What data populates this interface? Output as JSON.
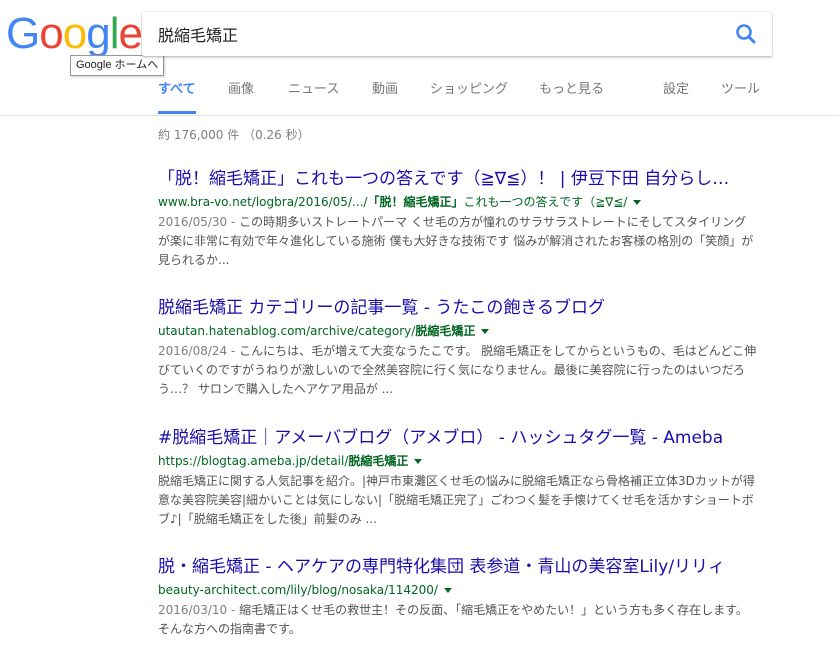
{
  "logo": {
    "letters": [
      "G",
      "o",
      "o",
      "g",
      "l",
      "e"
    ],
    "colors": [
      "#4285f4",
      "#ea4335",
      "#fbbc05",
      "#4285f4",
      "#34a853",
      "#ea4335"
    ]
  },
  "tooltip": "Google ホームへ",
  "search": {
    "query": "脱縮毛矯正",
    "icon": "search-icon",
    "accent": "#4285f4"
  },
  "tabs": [
    "すべて",
    "画像",
    "ニュース",
    "動画",
    "ショッピング",
    "もっと見る",
    "設定",
    "ツール"
  ],
  "stats": "約 176,000 件 （0.26 秒）",
  "results": [
    {
      "title": "「脱！縮毛矯正」これも一つの答えです（≧∇≦）！ | 伊豆下田 自分らし…",
      "url_pre": "www.bra-vo.net/logbra/2016/05/.../",
      "url_bold": "「脱！縮毛矯正」",
      "url_post": "これも一つの答えです（≧∇≦/",
      "date": "2016/05/30 - ",
      "snippet": "この時期多いストレートパーマ くせ毛の方が憧れのサラサラストレートにそしてスタイリングが楽に非常に有効で年々進化している施術 僕も大好きな技術です 悩みが解消されたお客様の格別の「笑顔」が見られるか..."
    },
    {
      "title": "脱縮毛矯正 カテゴリーの記事一覧 - うたこの飽きるブログ",
      "url_pre": "utautan.hatenablog.com/archive/category/",
      "url_bold": "脱縮毛矯正",
      "url_post": "",
      "date": "2016/08/24 - ",
      "snippet": "こんにちは、毛が増えて大変なうたこです。 脱縮毛矯正をしてからというもの、毛はどんどこ伸びていくのですがうねりが激しいので全然美容院に行く気になりません。最後に美容院に行ったのはいつだろう…？ サロンで購入したヘアケア用品が ..."
    },
    {
      "title": "#脱縮毛矯正｜アメーバブログ（アメブロ） - ハッシュタグ一覧 - Ameba",
      "url_pre": "https://blogtag.ameba.jp/detail/",
      "url_bold": "脱縮毛矯正",
      "url_post": "",
      "date": "",
      "snippet": "脱縮毛矯正に関する人気記事を紹介。|神戸市東灘区くせ毛の悩みに脱縮毛矯正なら骨格補正立体3Dカットが得意な美容院美容|細かいことは気にしない|「脱縮毛矯正完了」ごわつく髪を手懐けてくせ毛を活かすショートボブ♪|「脱縮毛矯正をした後」前髪のみ ..."
    },
    {
      "title": "脱・縮毛矯正 - ヘアケアの専門特化集団 表参道・青山の美容室Lily/リリィ",
      "url_pre": "beauty-architect.com/lily/blog/nosaka/114200/",
      "url_bold": "",
      "url_post": "",
      "date": "2016/03/10 - ",
      "snippet": "縮毛矯正はくせ毛の救世主！その反面、「縮毛矯正をやめたい！」という方も多く存在します。そんな方への指南書です。"
    }
  ]
}
